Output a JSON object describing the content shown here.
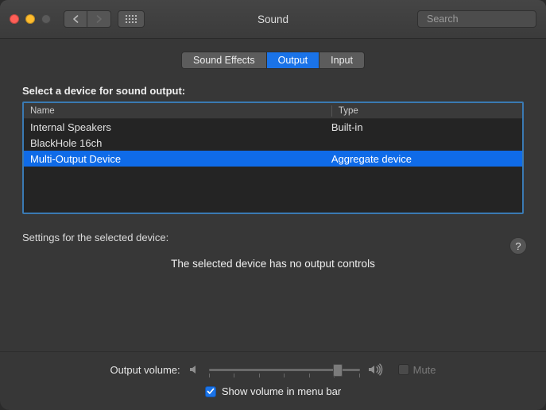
{
  "window": {
    "title": "Sound"
  },
  "search": {
    "placeholder": "Search"
  },
  "tabs": {
    "effects": "Sound Effects",
    "output": "Output",
    "input": "Input",
    "active": "output"
  },
  "section": {
    "select_label": "Select a device for sound output:",
    "columns": {
      "name": "Name",
      "type": "Type"
    },
    "devices": [
      {
        "name": "Internal Speakers",
        "type": "Built-in",
        "selected": false
      },
      {
        "name": "BlackHole 16ch",
        "type": "",
        "selected": false
      },
      {
        "name": "Multi-Output Device",
        "type": "Aggregate device",
        "selected": true
      }
    ],
    "settings_label": "Settings for the selected device:",
    "no_controls": "The selected device has no output controls"
  },
  "help": {
    "glyph": "?"
  },
  "volume": {
    "label": "Output volume:",
    "mute_label": "Mute",
    "mute_checked": false,
    "value_percent": 88
  },
  "menubar": {
    "label": "Show volume in menu bar",
    "checked": true
  }
}
